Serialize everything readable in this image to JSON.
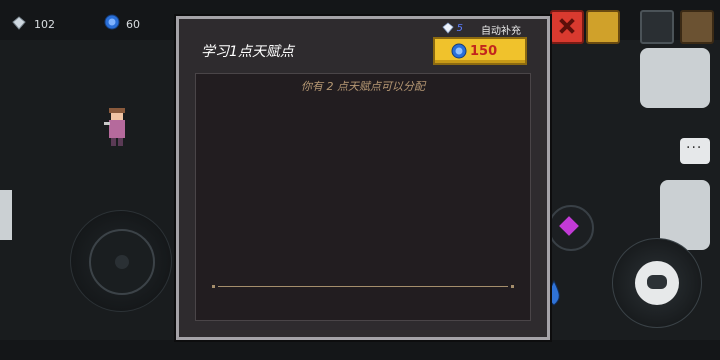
{
  "hud": {
    "gems": "102",
    "coins": "60"
  },
  "dialog": {
    "title": "学习1点天赋点",
    "diamond_count": "5",
    "auto_refill_label": "自动补充",
    "cost_value": "150",
    "points_message": "你有 2 点天赋点可以分配"
  },
  "colors": {
    "modal_bg": "#2e2b2e",
    "modal_border": "#a5a3a8",
    "cost_button": "#f0c22c",
    "cost_text": "#c2251d",
    "points_text": "#b79974"
  },
  "icons": [
    "gem-icon",
    "coin-icon",
    "diamond-icon",
    "close-icon",
    "chat-icon",
    "skill-gem-icon"
  ]
}
